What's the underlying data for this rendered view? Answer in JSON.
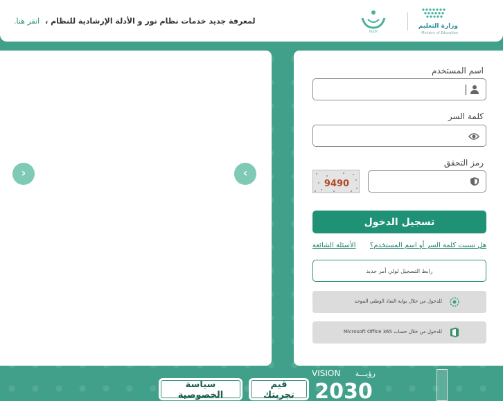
{
  "header": {
    "announcement": "لمعرفة جديد خدمات نظام نور و الأدلة الإرشادية للنظام ،",
    "announcement_link": "انقر هنا.",
    "ministry_name": "وزارة التعليم",
    "ministry_name_en": "Ministry of Education",
    "noor_logo_text": "NOOR"
  },
  "login": {
    "username_label": "اسم المستخدم",
    "username_value": "",
    "password_label": "كلمة السر",
    "password_value": "",
    "captcha_label": "رمز التحقق",
    "captcha_value": "",
    "captcha_text": "9490",
    "login_button": "تسجيل الدخول",
    "forgot_link": "هل نسيت كلمة السر أو اسم المستخدم؟",
    "faq_link": "الأسئلة الشائعة",
    "guardian_button": "رابط التسجيل لولي أمر جديد",
    "nafath_button": "للدخول من خلال بوابة النفاذ الوطني الموحد",
    "office_button": "للدخول من خلال حساب Microsoft Office 365"
  },
  "carousel": {
    "prev_arrow": "‹",
    "next_arrow": "›"
  },
  "footer": {
    "privacy_button": "سياسة الخصوصية",
    "rate_button": "قيم تجربتك",
    "vision_en": "VISION",
    "vision_ar": "رؤيـــة",
    "vision_year": "2030"
  },
  "colors": {
    "brand_green": "#1f9276",
    "background": "#41a089",
    "accent_light": "#7fc9b7"
  }
}
